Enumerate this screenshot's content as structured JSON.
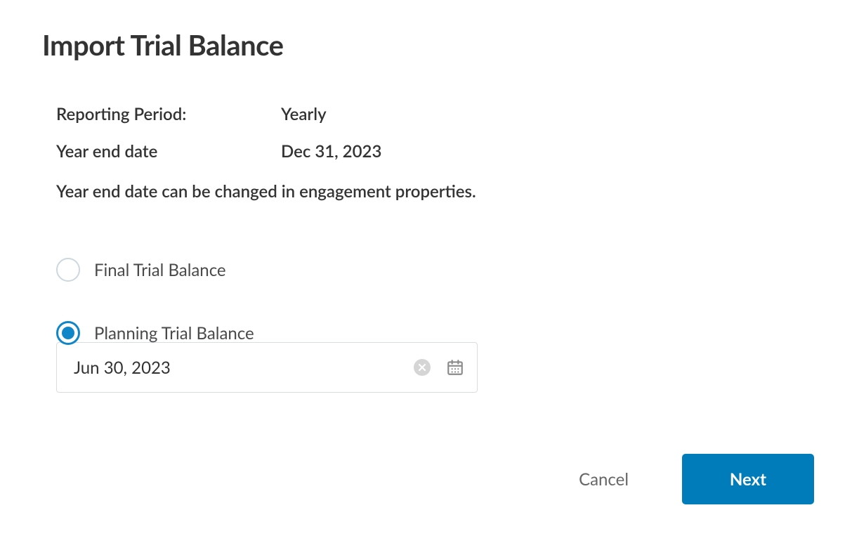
{
  "title": "Import Trial Balance",
  "info": {
    "reporting_period_label": "Reporting Period:",
    "reporting_period_value": "Yearly",
    "year_end_label": "Year end date",
    "year_end_value": "Dec 31, 2023",
    "note": "Year end date can be changed in engagement properties."
  },
  "options": {
    "final": {
      "label": "Final Trial Balance",
      "selected": false
    },
    "planning": {
      "label": "Planning Trial Balance",
      "selected": true
    }
  },
  "date_input": {
    "value": "Jun 30, 2023"
  },
  "footer": {
    "cancel_label": "Cancel",
    "next_label": "Next"
  }
}
